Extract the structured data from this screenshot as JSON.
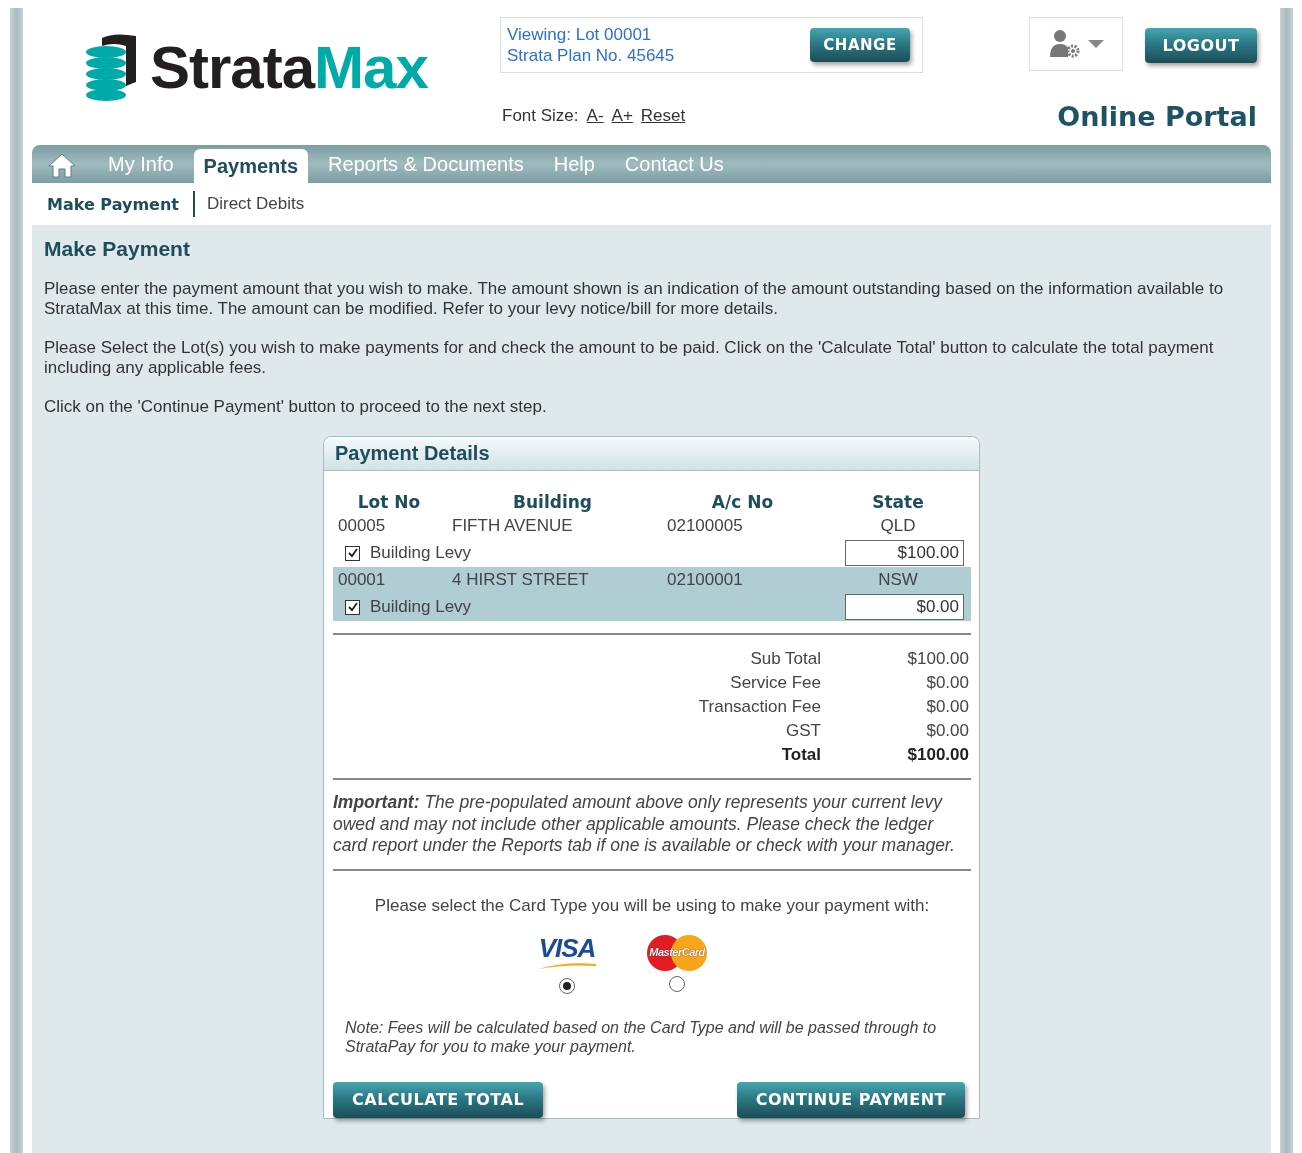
{
  "logo": {
    "text_1": "Strata",
    "text_2": "Max"
  },
  "viewing": {
    "line_1": "Viewing: Lot 00001",
    "line_2": "Strata Plan No. 45645",
    "button": "CHANGE"
  },
  "logout": "LOGOUT",
  "font_size": {
    "label": "Font Size:",
    "links": [
      "A-",
      "A+",
      "Reset"
    ]
  },
  "portal_title": "Online Portal",
  "nav": [
    {
      "label": "My Info",
      "selected": false
    },
    {
      "label": "Payments",
      "selected": true
    },
    {
      "label": "Reports & Documents",
      "selected": false
    },
    {
      "label": "Help",
      "selected": false
    },
    {
      "label": "Contact Us",
      "selected": false
    }
  ],
  "subnav": [
    {
      "label": "Make Payment",
      "selected": true
    },
    {
      "label": "Direct Debits",
      "selected": false
    }
  ],
  "page_title": "Make Payment",
  "paragraphs": [
    "Please enter the payment amount that you wish to make. The amount shown is an indication of the amount outstanding based on the information available to StrataMax at this time. The amount can be modified. Refer to your levy notice/bill for more details.",
    "Please Select the Lot(s) you wish to make payments for and check the amount to be paid. Click on the 'Calculate Total' button to calculate the total payment including any applicable fees.",
    "Click on the 'Continue Payment' button to proceed to the next step."
  ],
  "payment_details": {
    "title": "Payment Details",
    "columns": [
      "Lot No",
      "Building",
      "A/c No",
      "State"
    ],
    "lots": [
      {
        "lot_no": "00005",
        "building": "FIFTH AVENUE",
        "ac_no": "02100005",
        "state": "QLD",
        "highlighted": false,
        "levy": {
          "label": "Building Levy",
          "checked": true,
          "amount": "$100.00"
        }
      },
      {
        "lot_no": "00001",
        "building": "4 HIRST STREET",
        "ac_no": "02100001",
        "state": "NSW",
        "highlighted": true,
        "levy": {
          "label": "Building Levy",
          "checked": true,
          "amount": "$0.00"
        }
      }
    ],
    "totals": [
      {
        "label": "Sub Total",
        "value": "$100.00",
        "emphasis": false
      },
      {
        "label": "Service Fee",
        "value": "$0.00",
        "emphasis": false
      },
      {
        "label": "Transaction Fee",
        "value": "$0.00",
        "emphasis": false
      },
      {
        "label": "GST",
        "value": "$0.00",
        "emphasis": false
      },
      {
        "label": "Total",
        "value": "$100.00",
        "emphasis": true
      }
    ],
    "important": "**Important:** The pre-populated amount above only represents your current levy owed and may not include other applicable amounts. Please check the ledger card report under the Reports tab if one is available or check with your manager.",
    "card_prompt": "Please select the Card Type you will be using to make your payment with:",
    "cards": [
      {
        "kind": "visa",
        "label": "VISA",
        "selected": true
      },
      {
        "kind": "mastercard",
        "label": "MasterCard",
        "selected": false
      }
    ],
    "note": "Note: Fees will be calculated based on the Card Type and will be passed through to StrataPay for you to make your payment.",
    "buttons": [
      "CALCULATE TOTAL",
      "CONTINUE PAYMENT"
    ]
  }
}
